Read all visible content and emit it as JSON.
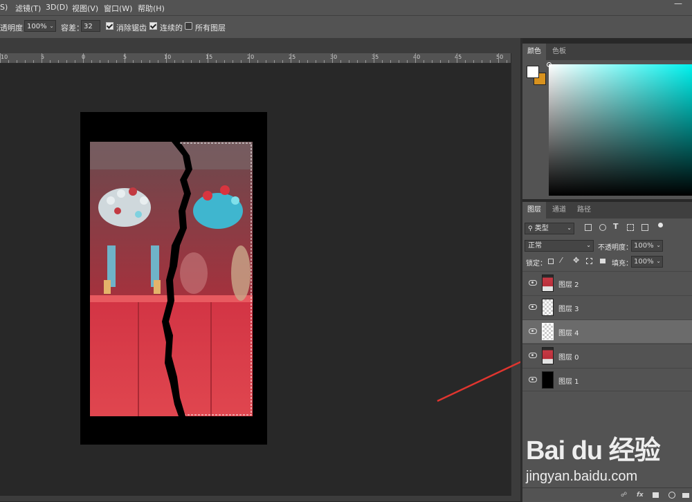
{
  "menubar": {
    "items": [
      "S)",
      "滤镜(T)",
      "3D(D)",
      "视图(V)",
      "窗口(W)",
      "帮助(H)"
    ],
    "minimize_glyph": "—"
  },
  "options": {
    "opacity_label": "透明度：",
    "opacity_value": "100%",
    "tolerance_label": "容差：",
    "tolerance_value": "32",
    "antialias_label": "消除锯齿",
    "antialias_checked": true,
    "contiguous_label": "连续的",
    "contiguous_checked": true,
    "all_layers_label": "所有图层",
    "all_layers_checked": false
  },
  "ruler": {
    "labels": [
      "10",
      "5",
      "0",
      "5",
      "10",
      "15",
      "20",
      "25",
      "30",
      "35",
      "40",
      "45",
      "50"
    ]
  },
  "color_panel": {
    "tabs": [
      "颜色",
      "色板"
    ],
    "foreground_color": "#ffffff",
    "background_color": "#d8921e"
  },
  "layers_panel": {
    "tabs": [
      "图层",
      "通道",
      "路径"
    ],
    "filter_kind": "类型",
    "blend_mode": "正常",
    "opacity_label": "不透明度：",
    "opacity_value": "100%",
    "lock_label": "锁定：",
    "fill_label": "填充：",
    "fill_value": "100%",
    "layers": [
      {
        "name": "图层 2",
        "thumb": "photo",
        "selected": false
      },
      {
        "name": "图层 3",
        "thumb": "checker",
        "selected": false
      },
      {
        "name": "图层 4",
        "thumb": "checker",
        "selected": true
      },
      {
        "name": "图层 0",
        "thumb": "photo",
        "selected": false
      },
      {
        "name": "图层 1",
        "thumb": "black",
        "selected": false
      }
    ],
    "bottom_icons": [
      "link-icon",
      "fx-icon",
      "mask-icon",
      "adjustment-icon",
      "folder-icon"
    ],
    "fx_label": "fx"
  },
  "watermark": {
    "logo": "Bai du 经验",
    "url": "jingyan.baidu.com"
  }
}
